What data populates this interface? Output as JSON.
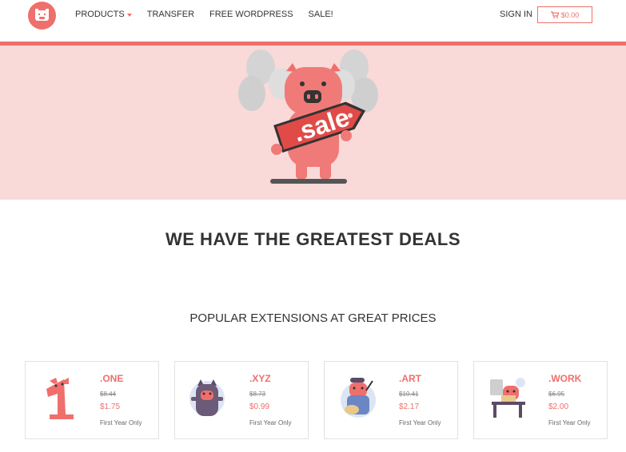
{
  "header": {
    "nav": [
      {
        "label": "PRODUCTS",
        "has_caret": true
      },
      {
        "label": "TRANSFER"
      },
      {
        "label": "FREE WORDPRESS"
      },
      {
        "label": "SALE!"
      }
    ],
    "sign_in": "SIGN IN",
    "cart_total": "$0.00"
  },
  "hero": {
    "sign_text": ".sale"
  },
  "headline": "WE HAVE THE GREATEST DEALS",
  "subhead": "POPULAR EXTENSIONS AT GREAT PRICES",
  "cards": [
    {
      "extension": ".ONE",
      "old_price": "$8.44",
      "new_price": "$1.75",
      "note": "First Year Only"
    },
    {
      "extension": ".XYZ",
      "old_price": "$8.73",
      "new_price": "$0.99",
      "note": "First Year Only"
    },
    {
      "extension": ".ART",
      "old_price": "$10.41",
      "new_price": "$2.17",
      "note": "First Year Only"
    },
    {
      "extension": ".WORK",
      "old_price": "$6.95",
      "new_price": "$2.00",
      "note": "First Year Only"
    }
  ],
  "colors": {
    "accent": "#ef6f6c",
    "hero_bg": "#fad9d9",
    "text": "#333333"
  }
}
